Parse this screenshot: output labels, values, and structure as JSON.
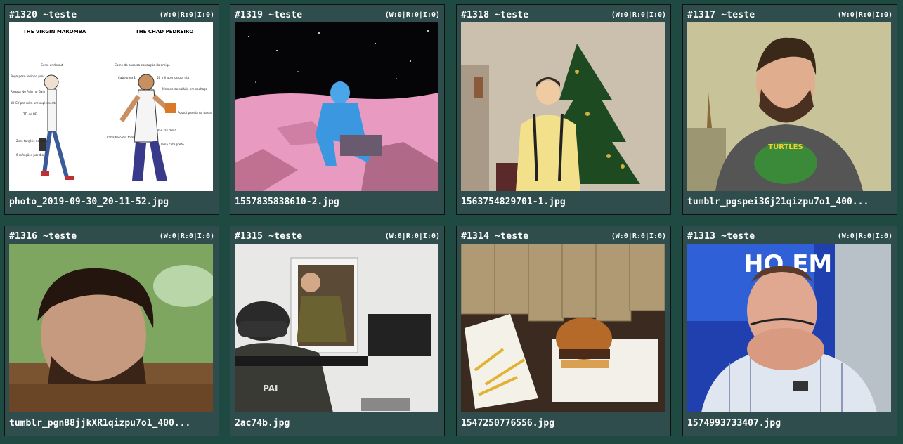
{
  "posts": [
    {
      "id": "#1320 ~teste",
      "stats": "(W:0|R:0|I:0)",
      "filename": "photo_2019-09-30_20-11-52.jpg",
      "image": "virgin-vs-chad-meme",
      "meme": {
        "left_title": "THE VIRGIN MAROMBA",
        "right_title": "THE CHAD PEDREIRO",
        "left_labels": [
          "Corte undercut",
          "Pega peso levinho pros",
          "Regata No Pain no Gain",
          "WHEY pra mim um suplemento",
          "TTI de BF",
          "Zero torções no peito",
          "6 refeições por dia"
        ],
        "right_labels": [
          "Come da casa da condução do amigo",
          "Cabelo na 1",
          "50 mil acertos por dia",
          "Metade do salário em cachaça",
          "Possui panela na barra",
          "Não faz dieta",
          "Trabalha o dia todo",
          "Toma café preto"
        ]
      }
    },
    {
      "id": "#1319 ~teste",
      "stats": "(W:0|R:0|I:0)",
      "filename": "1557835838610-2.jpg",
      "image": "blue-figure-on-pink-moon"
    },
    {
      "id": "#1318 ~teste",
      "stats": "(W:0|R:0|I:0)",
      "filename": "1563754829701-1.jpg",
      "image": "person-by-christmas-tree"
    },
    {
      "id": "#1317 ~teste",
      "stats": "(W:0|R:0|I:0)",
      "filename": "tumblr_pgspei3Gj21qizpu7o1_400...",
      "image": "man-in-turtles-shirt",
      "shirt_text": "TURTLES"
    },
    {
      "id": "#1316 ~teste",
      "stats": "(W:0|R:0|I:0)",
      "filename": "tumblr_pgn88jjkXR1qizpu7o1_400...",
      "image": "man-buried-in-dirt"
    },
    {
      "id": "#1315 ~teste",
      "stats": "(W:0|R:0|I:0)",
      "filename": "2ac74b.jpg",
      "image": "swat-and-man-in-cabinet",
      "vest_text": "PAI"
    },
    {
      "id": "#1314 ~teste",
      "stats": "(W:0|R:0|I:0)",
      "filename": "1547250776556.jpg",
      "image": "cash-stacks-and-burger"
    },
    {
      "id": "#1313 ~teste",
      "stats": "(W:0|R:0|I:0)",
      "filename": "1574993733407.jpg",
      "image": "man-crying-on-tv",
      "tv_text": "HO EM"
    }
  ]
}
